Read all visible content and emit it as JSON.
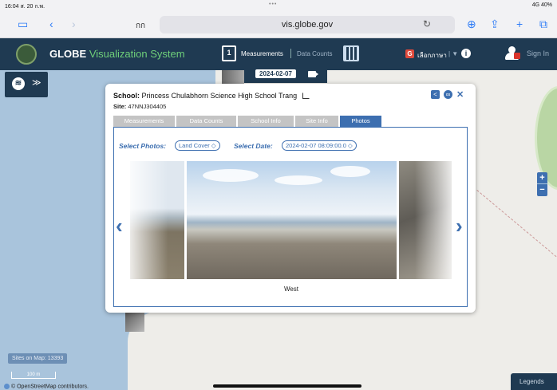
{
  "status_bar": {
    "time": "16:04  ส. 20 ก.พ.",
    "dots": "•••",
    "signal": "4G 40%"
  },
  "safari": {
    "tab_title": "กก",
    "url": "vis.globe.gov"
  },
  "header": {
    "app_name": "GLOBE",
    "app_name_accent": "Visualization System",
    "calendar_day": "1",
    "measurements": "Measurements",
    "data_counts": "Data Counts",
    "language": "เลือกภาษา",
    "language_sep": "| ▼",
    "sign_in": "Sign In"
  },
  "date_bar": {
    "date": "2024-02-07"
  },
  "popup": {
    "school_label": "School:",
    "school_name": "Princess Chulabhorn Science High School Trang",
    "site_label": "Site:",
    "site_id": "47NNJ304405",
    "tabs": [
      "Measurements",
      "Data Counts",
      "School Info",
      "Site Info",
      "Photos"
    ],
    "select_photos_label": "Select Photos:",
    "select_photos_value": "Land Cover ◇",
    "select_date_label": "Select Date:",
    "select_date_value": "2024-02-07 08:09:00.0 ◇",
    "caption": "West"
  },
  "map": {
    "sites_on_map": "Sites on Map: 13393",
    "scale": "100 m",
    "attribution": "© OpenStreetMap contributors.",
    "legends": "Legends"
  },
  "colors": {
    "header_bg": "#1f3a52",
    "accent_blue": "#3d6fb0",
    "accent_green": "#6fd07a",
    "water": "#a9c4dc"
  }
}
